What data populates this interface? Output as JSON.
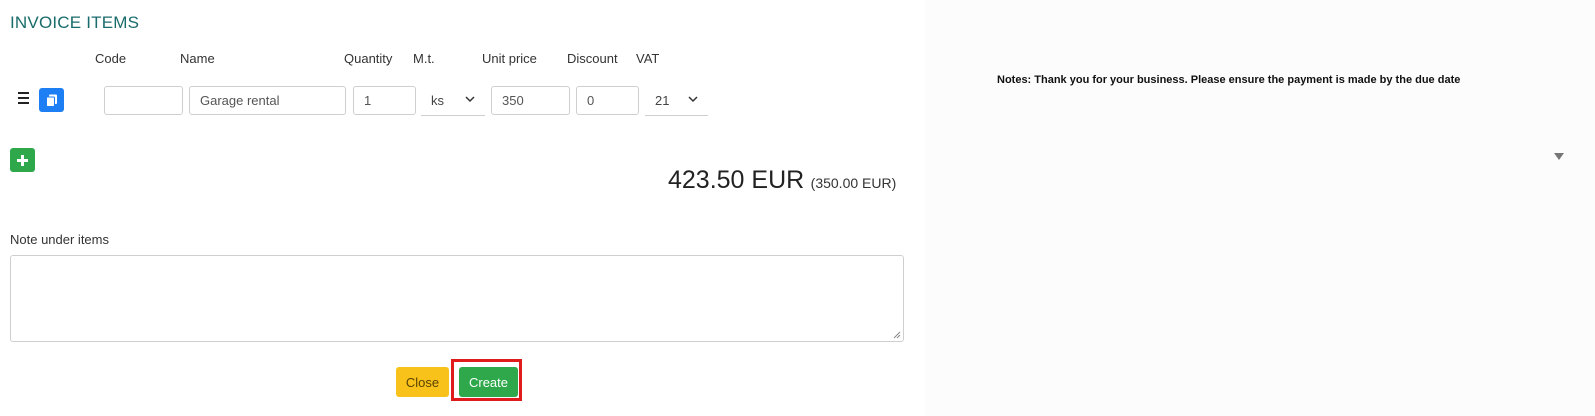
{
  "section": {
    "title": "INVOICE ITEMS"
  },
  "columns": {
    "code": "Code",
    "name": "Name",
    "quantity": "Quantity",
    "mu": "M.t.",
    "unit_price": "Unit price",
    "discount": "Discount",
    "vat": "VAT"
  },
  "item": {
    "code": "",
    "name": "Garage rental",
    "quantity": "1",
    "unit": "ks",
    "unit_price": "350",
    "discount": "0",
    "vat": "21"
  },
  "totals": {
    "total": "423.50 EUR",
    "subtotal": "(350.00 EUR)"
  },
  "note": {
    "label": "Note under items",
    "value": ""
  },
  "buttons": {
    "close": "Close",
    "create": "Create"
  },
  "notes_panel": {
    "text": "Notes:  Thank you for your business. Please ensure the payment is made by the due date"
  },
  "colors": {
    "accent_blue": "#1e7ff5",
    "accent_green": "#2ea84a",
    "close_yellow": "#f8c21a",
    "highlight_red": "#e01b1b",
    "title_teal": "#1a6b6b"
  },
  "icons": [
    "drag-handle-icon",
    "copy-icon",
    "plus-icon",
    "chevron-down-icon",
    "resize-grip-icon",
    "scroll-down-icon"
  ]
}
